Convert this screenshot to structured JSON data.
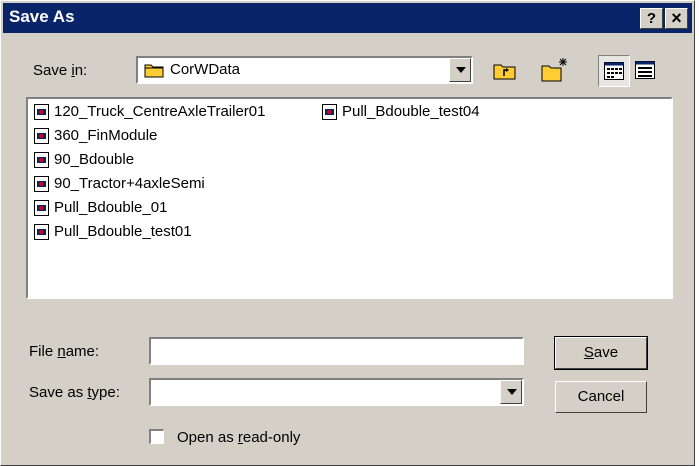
{
  "window": {
    "title": "Save As",
    "help_button": "?",
    "close_button": "×"
  },
  "save_in": {
    "label_pre": "Save ",
    "label_key": "i",
    "label_post": "n:",
    "value": "CorWData",
    "icon": "folder-icon"
  },
  "toolbar": {
    "buttons": [
      "up-one-level-icon",
      "create-new-folder-icon",
      "list-view-icon",
      "details-view-icon"
    ],
    "active_view": "list"
  },
  "files": [
    "120_Truck_CentreAxleTrailer01",
    "360_FinModule",
    "90_Bdouble",
    "90_Tractor+4axleSemi",
    "Pull_Bdouble_01",
    "Pull_Bdouble_test01",
    "Pull_Bdouble_test04"
  ],
  "file_name": {
    "label_pre": "File ",
    "label_key": "n",
    "label_post": "ame:",
    "value": ""
  },
  "save_as_type": {
    "label_pre": "Save as ",
    "label_key": "t",
    "label_post": "ype:",
    "value": ""
  },
  "buttons": {
    "save_key": "S",
    "save_rest": "ave",
    "cancel": "Cancel"
  },
  "read_only": {
    "label_pre": "Open as ",
    "label_key": "r",
    "label_post": "ead-only",
    "checked": false
  },
  "colors": {
    "titlebar": "#0a246a",
    "face": "#d4d0c8",
    "folder": "#ffcc33"
  }
}
